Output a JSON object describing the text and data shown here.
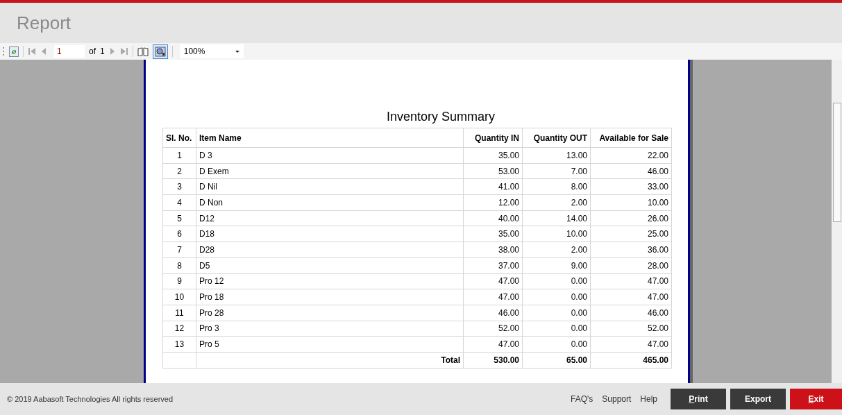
{
  "header": {
    "title": "Report"
  },
  "toolbar": {
    "page": "1",
    "of_label": "of",
    "page_count": "1",
    "zoom": "100%",
    "layout_pressed": true
  },
  "report": {
    "title": "Inventory Summary",
    "columns": [
      "Sl. No.",
      "Item Name",
      "Quantity IN",
      "Quantity OUT",
      "Available for Sale"
    ],
    "rows": [
      [
        "1",
        "D 3",
        "35.00",
        "13.00",
        "22.00"
      ],
      [
        "2",
        "D Exem",
        "53.00",
        "7.00",
        "46.00"
      ],
      [
        "3",
        "D Nil",
        "41.00",
        "8.00",
        "33.00"
      ],
      [
        "4",
        "D Non",
        "12.00",
        "2.00",
        "10.00"
      ],
      [
        "5",
        "D12",
        "40.00",
        "14.00",
        "26.00"
      ],
      [
        "6",
        "D18",
        "35.00",
        "10.00",
        "25.00"
      ],
      [
        "7",
        "D28",
        "38.00",
        "2.00",
        "36.00"
      ],
      [
        "8",
        "D5",
        "37.00",
        "9.00",
        "28.00"
      ],
      [
        "9",
        "Pro 12",
        "47.00",
        "0.00",
        "47.00"
      ],
      [
        "10",
        "Pro 18",
        "47.00",
        "0.00",
        "47.00"
      ],
      [
        "11",
        "Pro 28",
        "46.00",
        "0.00",
        "46.00"
      ],
      [
        "12",
        "Pro 3",
        "52.00",
        "0.00",
        "52.00"
      ],
      [
        "13",
        "Pro 5",
        "47.00",
        "0.00",
        "47.00"
      ]
    ],
    "total": {
      "label": "Total",
      "values": [
        "530.00",
        "65.00",
        "465.00"
      ]
    }
  },
  "footer": {
    "copyright": "© 2019 Aabasoft Technologies All rights reserved",
    "links": [
      "FAQ's",
      "Support",
      "Help"
    ],
    "buttons": [
      {
        "label": "Print",
        "kind": "dark",
        "mnemonic": true
      },
      {
        "label": "Export",
        "kind": "dark",
        "mnemonic": false
      },
      {
        "label": "Exit",
        "kind": "danger",
        "mnemonic": true
      }
    ]
  }
}
